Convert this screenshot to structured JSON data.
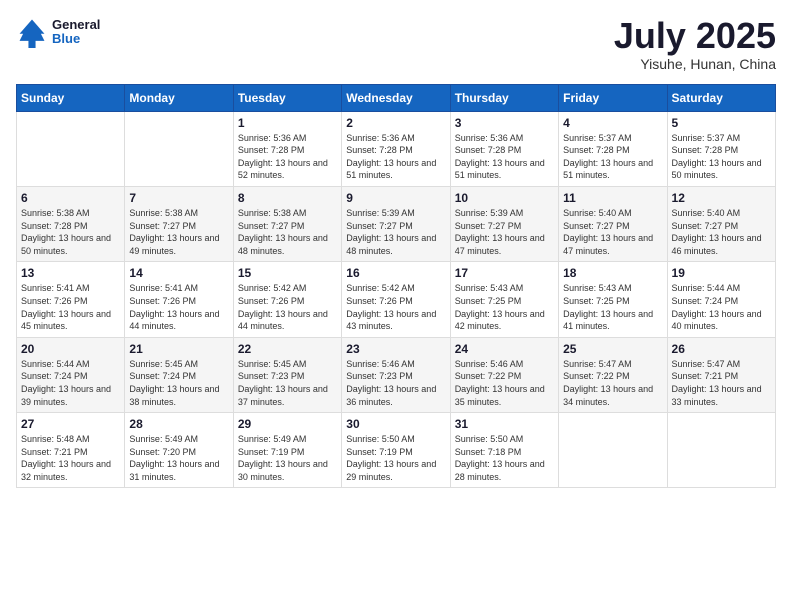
{
  "header": {
    "logo_general": "General",
    "logo_blue": "Blue",
    "month_year": "July 2025",
    "location": "Yisuhe, Hunan, China"
  },
  "days_of_week": [
    "Sunday",
    "Monday",
    "Tuesday",
    "Wednesday",
    "Thursday",
    "Friday",
    "Saturday"
  ],
  "weeks": [
    [
      {
        "day": "",
        "sunrise": "",
        "sunset": "",
        "daylight": ""
      },
      {
        "day": "",
        "sunrise": "",
        "sunset": "",
        "daylight": ""
      },
      {
        "day": "1",
        "sunrise": "Sunrise: 5:36 AM",
        "sunset": "Sunset: 7:28 PM",
        "daylight": "Daylight: 13 hours and 52 minutes."
      },
      {
        "day": "2",
        "sunrise": "Sunrise: 5:36 AM",
        "sunset": "Sunset: 7:28 PM",
        "daylight": "Daylight: 13 hours and 51 minutes."
      },
      {
        "day": "3",
        "sunrise": "Sunrise: 5:36 AM",
        "sunset": "Sunset: 7:28 PM",
        "daylight": "Daylight: 13 hours and 51 minutes."
      },
      {
        "day": "4",
        "sunrise": "Sunrise: 5:37 AM",
        "sunset": "Sunset: 7:28 PM",
        "daylight": "Daylight: 13 hours and 51 minutes."
      },
      {
        "day": "5",
        "sunrise": "Sunrise: 5:37 AM",
        "sunset": "Sunset: 7:28 PM",
        "daylight": "Daylight: 13 hours and 50 minutes."
      }
    ],
    [
      {
        "day": "6",
        "sunrise": "Sunrise: 5:38 AM",
        "sunset": "Sunset: 7:28 PM",
        "daylight": "Daylight: 13 hours and 50 minutes."
      },
      {
        "day": "7",
        "sunrise": "Sunrise: 5:38 AM",
        "sunset": "Sunset: 7:27 PM",
        "daylight": "Daylight: 13 hours and 49 minutes."
      },
      {
        "day": "8",
        "sunrise": "Sunrise: 5:38 AM",
        "sunset": "Sunset: 7:27 PM",
        "daylight": "Daylight: 13 hours and 48 minutes."
      },
      {
        "day": "9",
        "sunrise": "Sunrise: 5:39 AM",
        "sunset": "Sunset: 7:27 PM",
        "daylight": "Daylight: 13 hours and 48 minutes."
      },
      {
        "day": "10",
        "sunrise": "Sunrise: 5:39 AM",
        "sunset": "Sunset: 7:27 PM",
        "daylight": "Daylight: 13 hours and 47 minutes."
      },
      {
        "day": "11",
        "sunrise": "Sunrise: 5:40 AM",
        "sunset": "Sunset: 7:27 PM",
        "daylight": "Daylight: 13 hours and 47 minutes."
      },
      {
        "day": "12",
        "sunrise": "Sunrise: 5:40 AM",
        "sunset": "Sunset: 7:27 PM",
        "daylight": "Daylight: 13 hours and 46 minutes."
      }
    ],
    [
      {
        "day": "13",
        "sunrise": "Sunrise: 5:41 AM",
        "sunset": "Sunset: 7:26 PM",
        "daylight": "Daylight: 13 hours and 45 minutes."
      },
      {
        "day": "14",
        "sunrise": "Sunrise: 5:41 AM",
        "sunset": "Sunset: 7:26 PM",
        "daylight": "Daylight: 13 hours and 44 minutes."
      },
      {
        "day": "15",
        "sunrise": "Sunrise: 5:42 AM",
        "sunset": "Sunset: 7:26 PM",
        "daylight": "Daylight: 13 hours and 44 minutes."
      },
      {
        "day": "16",
        "sunrise": "Sunrise: 5:42 AM",
        "sunset": "Sunset: 7:26 PM",
        "daylight": "Daylight: 13 hours and 43 minutes."
      },
      {
        "day": "17",
        "sunrise": "Sunrise: 5:43 AM",
        "sunset": "Sunset: 7:25 PM",
        "daylight": "Daylight: 13 hours and 42 minutes."
      },
      {
        "day": "18",
        "sunrise": "Sunrise: 5:43 AM",
        "sunset": "Sunset: 7:25 PM",
        "daylight": "Daylight: 13 hours and 41 minutes."
      },
      {
        "day": "19",
        "sunrise": "Sunrise: 5:44 AM",
        "sunset": "Sunset: 7:24 PM",
        "daylight": "Daylight: 13 hours and 40 minutes."
      }
    ],
    [
      {
        "day": "20",
        "sunrise": "Sunrise: 5:44 AM",
        "sunset": "Sunset: 7:24 PM",
        "daylight": "Daylight: 13 hours and 39 minutes."
      },
      {
        "day": "21",
        "sunrise": "Sunrise: 5:45 AM",
        "sunset": "Sunset: 7:24 PM",
        "daylight": "Daylight: 13 hours and 38 minutes."
      },
      {
        "day": "22",
        "sunrise": "Sunrise: 5:45 AM",
        "sunset": "Sunset: 7:23 PM",
        "daylight": "Daylight: 13 hours and 37 minutes."
      },
      {
        "day": "23",
        "sunrise": "Sunrise: 5:46 AM",
        "sunset": "Sunset: 7:23 PM",
        "daylight": "Daylight: 13 hours and 36 minutes."
      },
      {
        "day": "24",
        "sunrise": "Sunrise: 5:46 AM",
        "sunset": "Sunset: 7:22 PM",
        "daylight": "Daylight: 13 hours and 35 minutes."
      },
      {
        "day": "25",
        "sunrise": "Sunrise: 5:47 AM",
        "sunset": "Sunset: 7:22 PM",
        "daylight": "Daylight: 13 hours and 34 minutes."
      },
      {
        "day": "26",
        "sunrise": "Sunrise: 5:47 AM",
        "sunset": "Sunset: 7:21 PM",
        "daylight": "Daylight: 13 hours and 33 minutes."
      }
    ],
    [
      {
        "day": "27",
        "sunrise": "Sunrise: 5:48 AM",
        "sunset": "Sunset: 7:21 PM",
        "daylight": "Daylight: 13 hours and 32 minutes."
      },
      {
        "day": "28",
        "sunrise": "Sunrise: 5:49 AM",
        "sunset": "Sunset: 7:20 PM",
        "daylight": "Daylight: 13 hours and 31 minutes."
      },
      {
        "day": "29",
        "sunrise": "Sunrise: 5:49 AM",
        "sunset": "Sunset: 7:19 PM",
        "daylight": "Daylight: 13 hours and 30 minutes."
      },
      {
        "day": "30",
        "sunrise": "Sunrise: 5:50 AM",
        "sunset": "Sunset: 7:19 PM",
        "daylight": "Daylight: 13 hours and 29 minutes."
      },
      {
        "day": "31",
        "sunrise": "Sunrise: 5:50 AM",
        "sunset": "Sunset: 7:18 PM",
        "daylight": "Daylight: 13 hours and 28 minutes."
      },
      {
        "day": "",
        "sunrise": "",
        "sunset": "",
        "daylight": ""
      },
      {
        "day": "",
        "sunrise": "",
        "sunset": "",
        "daylight": ""
      }
    ]
  ]
}
